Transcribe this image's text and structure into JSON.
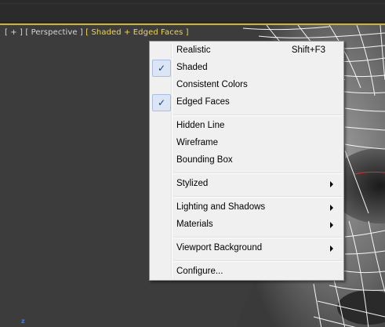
{
  "viewport": {
    "label_open": "[ + ]",
    "label_view": "[ Perspective ]",
    "label_shading": "[ Shaded + Edged Faces ]",
    "axis_label": "z"
  },
  "menu": {
    "items": [
      {
        "label": "Realistic",
        "shortcut": "Shift+F3",
        "checked": false
      },
      {
        "label": "Shaded",
        "checked": true
      },
      {
        "label": "Consistent Colors",
        "checked": false
      },
      {
        "label": "Edged Faces",
        "checked": true
      },
      {
        "label": "Hidden Line"
      },
      {
        "label": "Wireframe"
      },
      {
        "label": "Bounding Box"
      },
      {
        "label": "Stylized",
        "submenu": true
      },
      {
        "label": "Lighting and Shadows",
        "submenu": true
      },
      {
        "label": "Materials",
        "submenu": true
      },
      {
        "label": "Viewport Background",
        "submenu": true
      },
      {
        "label": "Configure..."
      }
    ],
    "check_glyph": "✓"
  },
  "colors": {
    "viewport_bg": "#3c3c3c",
    "active_border": "#c9b13a",
    "active_label": "#f2d64a",
    "menu_bg": "#f0f0f0",
    "check_highlight": "#dce5f3"
  }
}
